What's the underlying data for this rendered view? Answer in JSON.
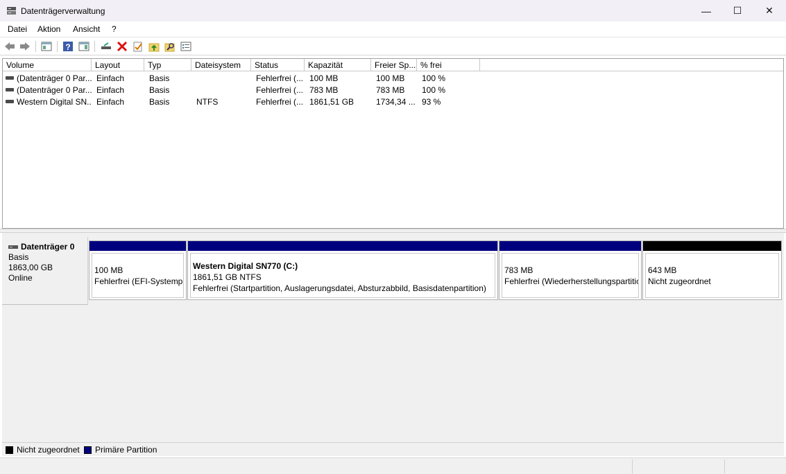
{
  "window": {
    "title": "Datenträgerverwaltung",
    "minimize_glyph": "—",
    "maximize_glyph": "☐",
    "close_glyph": "✕"
  },
  "menu": {
    "items": [
      "Datei",
      "Aktion",
      "Ansicht",
      "?"
    ]
  },
  "toolbar": {
    "icons": [
      "back-arrow-icon",
      "forward-arrow-icon",
      "console-tree-icon",
      "help-icon",
      "action-pane-icon",
      "connect-disk-icon",
      "delete-icon",
      "check-properties-icon",
      "folder-up-icon",
      "folder-search-icon",
      "properties-list-icon"
    ]
  },
  "volume_list": {
    "columns": [
      "Volume",
      "Layout",
      "Typ",
      "Dateisystem",
      "Status",
      "Kapazität",
      "Freier Sp...",
      "% frei"
    ],
    "rows": [
      {
        "volume": "(Datenträger 0 Par...",
        "layout": "Einfach",
        "typ": "Basis",
        "fs": "",
        "status": "Fehlerfrei (...",
        "kapazitaet": "100 MB",
        "frei": "100 MB",
        "prozent": "100 %"
      },
      {
        "volume": "(Datenträger 0 Par...",
        "layout": "Einfach",
        "typ": "Basis",
        "fs": "",
        "status": "Fehlerfrei (...",
        "kapazitaet": "783 MB",
        "frei": "783 MB",
        "prozent": "100 %"
      },
      {
        "volume": "Western Digital SN...",
        "layout": "Einfach",
        "typ": "Basis",
        "fs": "NTFS",
        "status": "Fehlerfrei (...",
        "kapazitaet": "1861,51 GB",
        "frei": "1734,34 ...",
        "prozent": "93 %"
      }
    ]
  },
  "disk": {
    "name": "Datenträger 0",
    "type": "Basis",
    "size": "1863,00 GB",
    "state": "Online",
    "partitions": [
      {
        "name": "",
        "line1": "100 MB",
        "line2": "Fehlerfrei (EFI-Systempa",
        "kind": "primary"
      },
      {
        "name": "Western Digital SN770  (C:)",
        "line1": "1861,51 GB NTFS",
        "line2": "Fehlerfrei (Startpartition, Auslagerungsdatei, Absturzabbild, Basisdatenpartition)",
        "kind": "primary"
      },
      {
        "name": "",
        "line1": "783 MB",
        "line2": "Fehlerfrei (Wiederherstellungspartitio",
        "kind": "primary"
      },
      {
        "name": "",
        "line1": "643 MB",
        "line2": "Nicht zugeordnet",
        "kind": "unallocated"
      }
    ]
  },
  "legend": {
    "unallocated_label": "Nicht zugeordnet",
    "primary_label": "Primäre Partition"
  },
  "colors": {
    "primary_partition": "#00007f",
    "unallocated": "#000000"
  }
}
